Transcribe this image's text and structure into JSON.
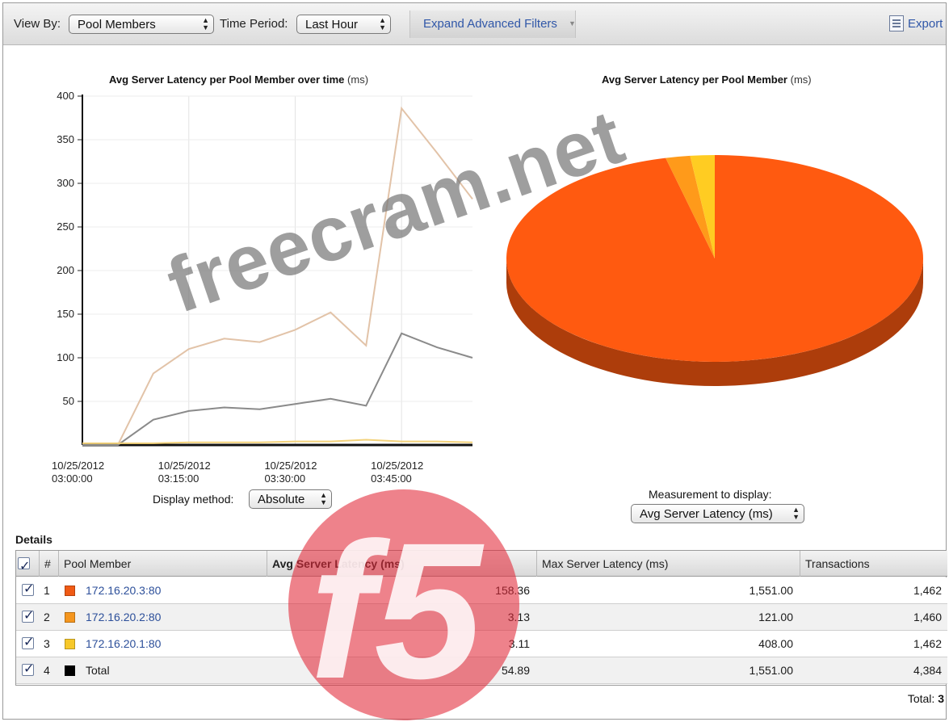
{
  "toolbar": {
    "view_by_label": "View By:",
    "view_by_value": "Pool Members",
    "time_period_label": "Time Period:",
    "time_period_value": "Last Hour",
    "expand_filters": "Expand Advanced Filters",
    "export_label": "Export",
    "icons": {
      "select_arrows": "updown-arrows-icon",
      "export": "export-document-icon"
    }
  },
  "line_chart": {
    "title": "Avg Server Latency per Pool Member over time",
    "unit": "(ms)",
    "display_method_label": "Display method:",
    "display_method_value": "Absolute"
  },
  "pie_chart": {
    "title": "Avg Server Latency per Pool Member",
    "unit": "(ms)",
    "measurement_label": "Measurement to display:",
    "measurement_value": "Avg Server Latency (ms)"
  },
  "chart_data": [
    {
      "type": "line",
      "title": "Avg Server Latency per Pool Member over time (ms)",
      "x": [
        0,
        1,
        2,
        3,
        4,
        5,
        6,
        7,
        8,
        9,
        10,
        11
      ],
      "x_tick_labels": [
        {
          "at": 0,
          "date": "10/25/2012",
          "time": "03:00:00"
        },
        {
          "at": 3,
          "date": "10/25/2012",
          "time": "03:15:00"
        },
        {
          "at": 6,
          "date": "10/25/2012",
          "time": "03:30:00"
        },
        {
          "at": 9,
          "date": "10/25/2012",
          "time": "03:45:00"
        }
      ],
      "x_range": [
        0,
        11
      ],
      "yticks": [
        50,
        100,
        150,
        200,
        250,
        300,
        350,
        400
      ],
      "ylim": [
        0,
        400
      ],
      "grid": true,
      "series": [
        {
          "color": "#e2c3a8",
          "values": [
            0,
            0,
            82,
            110,
            122,
            118,
            132,
            152,
            114,
            386,
            335,
            282
          ]
        },
        {
          "color": "#8a8a8a",
          "values": [
            0,
            0,
            29,
            39,
            43,
            41,
            47,
            53,
            45,
            128,
            112,
            100
          ]
        },
        {
          "color": "#f3d27a",
          "values": [
            2,
            2,
            2,
            3,
            3,
            3,
            4,
            4,
            6,
            4,
            4,
            3
          ]
        }
      ]
    },
    {
      "type": "pie",
      "title": "Avg Server Latency per Pool Member (ms)",
      "labels": [
        "172.16.20.3:80",
        "172.16.20.2:80",
        "172.16.20.1:80"
      ],
      "values": [
        158.36,
        3.13,
        3.11
      ],
      "colors": [
        "#ff5a10",
        "#ff9a1a",
        "#ffcc22"
      ]
    }
  ],
  "details": {
    "label": "Details",
    "columns": [
      "#",
      "Pool Member",
      "Avg Server Latency (ms)",
      "Max Server Latency (ms)",
      "Transactions"
    ],
    "rows": [
      {
        "n": "1",
        "member": "172.16.20.3:80",
        "color": "#f05a14",
        "avg": "158.36",
        "max": "1,551.00",
        "tx": "1,462",
        "link": true
      },
      {
        "n": "2",
        "member": "172.16.20.2:80",
        "color": "#f5961e",
        "avg": "3.13",
        "max": "121.00",
        "tx": "1,460",
        "link": true
      },
      {
        "n": "3",
        "member": "172.16.20.1:80",
        "color": "#f7c82a",
        "avg": "3.11",
        "max": "408.00",
        "tx": "1,462",
        "link": true
      },
      {
        "n": "4",
        "member": "Total",
        "color": "#000000",
        "avg": "54.89",
        "max": "1,551.00",
        "tx": "4,384",
        "link": false
      }
    ],
    "total_label": "Total:",
    "total_value": "3"
  },
  "watermark": {
    "text": "freecram.net",
    "logo_text": "f5"
  }
}
